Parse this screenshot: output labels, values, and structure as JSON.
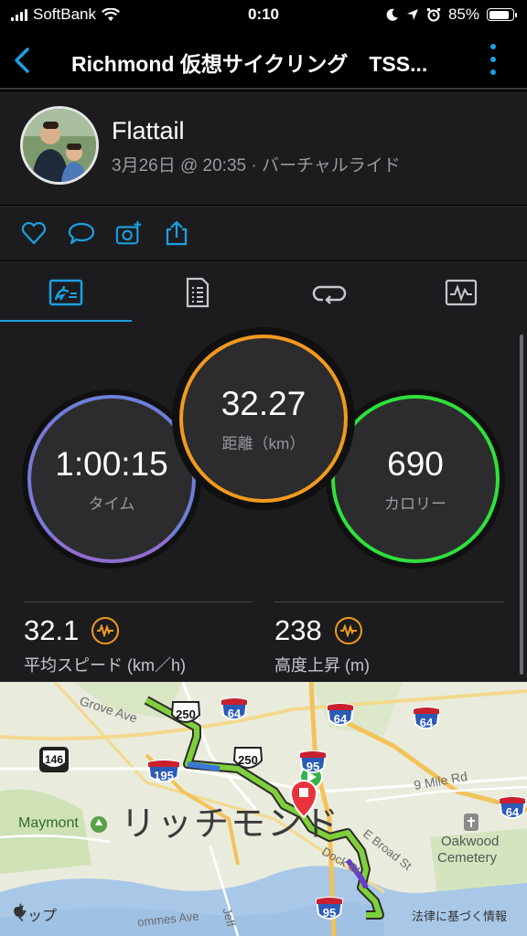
{
  "status_bar": {
    "carrier": "SoftBank",
    "time": "0:10",
    "battery": "85%"
  },
  "nav": {
    "title": "Richmond 仮想サイクリング　TSS..."
  },
  "activity": {
    "user_name": "Flattail",
    "meta": "3月26日 @ 20:35 · バーチャルライド"
  },
  "stats": {
    "time": {
      "value": "1:00:15",
      "label": "タイム",
      "color": "#6d7fd8"
    },
    "distance": {
      "value": "32.27",
      "label": "距離（km）",
      "color": "#f39a1e"
    },
    "calories": {
      "value": "690",
      "label": "カロリー",
      "color": "#2fe03c"
    },
    "avg_speed": {
      "value": "32.1",
      "label": "平均スピード (km／h)"
    },
    "elevation": {
      "value": "238",
      "label": "高度上昇 (m)"
    }
  },
  "map": {
    "city_label": "リッチモンド",
    "labels": {
      "grove_ave": "Grove Ave",
      "maymont": "Maymont",
      "nine_mile": "9 Mile Rd",
      "oakwood": "Oakwood",
      "cemetery": "Cemetery",
      "broad": "E Broad St",
      "dock": "Dock St",
      "jeff": "Jeff",
      "ommes": "ommes Ave"
    },
    "shields": {
      "i64_a": "64",
      "i64_b": "64",
      "i64_c": "64",
      "i64_d": "64",
      "i95_a": "95",
      "i95_b": "95",
      "i195": "195",
      "us250_a": "250",
      "us250_b": "250",
      "va146": "146"
    },
    "maps_logo": "マップ",
    "legal": "法律に基づく情報"
  },
  "colors": {
    "accent": "#1ba0e2",
    "background": "#1c1c1e"
  }
}
